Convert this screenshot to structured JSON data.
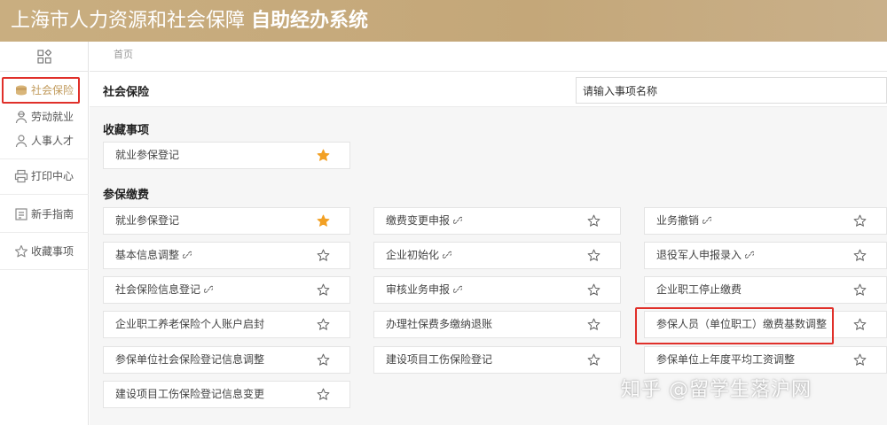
{
  "header": {
    "title_regular": "上海市人力资源和社会保障",
    "title_bold": "自助经办系统"
  },
  "sidebar": {
    "items": [
      {
        "label": "社会保险",
        "icon": "coins-icon",
        "active": true
      },
      {
        "label": "劳动就业",
        "icon": "worker-icon"
      },
      {
        "label": "人事人才",
        "icon": "user-icon"
      },
      {
        "label": "打印中心",
        "icon": "printer-icon"
      },
      {
        "label": "新手指南",
        "icon": "guide-icon"
      },
      {
        "label": "收藏事项",
        "icon": "star-icon"
      }
    ]
  },
  "breadcrumb": {
    "home": "首页"
  },
  "main": {
    "title": "社会保险",
    "search": {
      "value": "请输入事项名称"
    },
    "favorites": {
      "title": "收藏事项",
      "items": [
        {
          "label": "就业参保登记",
          "starred": true,
          "link": false
        }
      ]
    },
    "payment": {
      "title": "参保缴费",
      "col1": [
        {
          "label": "就业参保登记",
          "starred": true,
          "link": false
        },
        {
          "label": "基本信息调整",
          "starred": false,
          "link": true
        },
        {
          "label": "社会保险信息登记",
          "starred": false,
          "link": true
        },
        {
          "label": "企业职工养老保险个人账户启封",
          "starred": false,
          "link": false
        },
        {
          "label": "参保单位社会保险登记信息调整",
          "starred": false,
          "link": false
        },
        {
          "label": "建设项目工伤保险登记信息变更",
          "starred": false,
          "link": false
        }
      ],
      "col2": [
        {
          "label": "缴费变更申报",
          "starred": false,
          "link": true
        },
        {
          "label": "企业初始化",
          "starred": false,
          "link": true
        },
        {
          "label": "审核业务申报",
          "starred": false,
          "link": true
        },
        {
          "label": "办理社保费多缴纳退账",
          "starred": false,
          "link": false
        },
        {
          "label": "建设项目工伤保险登记",
          "starred": false,
          "link": false
        }
      ],
      "col3": [
        {
          "label": "业务撤销",
          "starred": false,
          "link": true
        },
        {
          "label": "退役军人申报录入",
          "starred": false,
          "link": true
        },
        {
          "label": "企业职工停止缴费",
          "starred": false,
          "link": false
        },
        {
          "label": "参保人员（单位职工）缴费基数调整",
          "starred": false,
          "link": false
        },
        {
          "label": "参保单位上年度平均工资调整",
          "starred": false,
          "link": false
        }
      ]
    }
  },
  "watermark": "知乎 @留学生落沪网",
  "colors": {
    "header_bg": "#c7ab7d",
    "accent": "#c19a5b",
    "star_filled": "#f2a024",
    "highlight_border": "#e0302a"
  }
}
